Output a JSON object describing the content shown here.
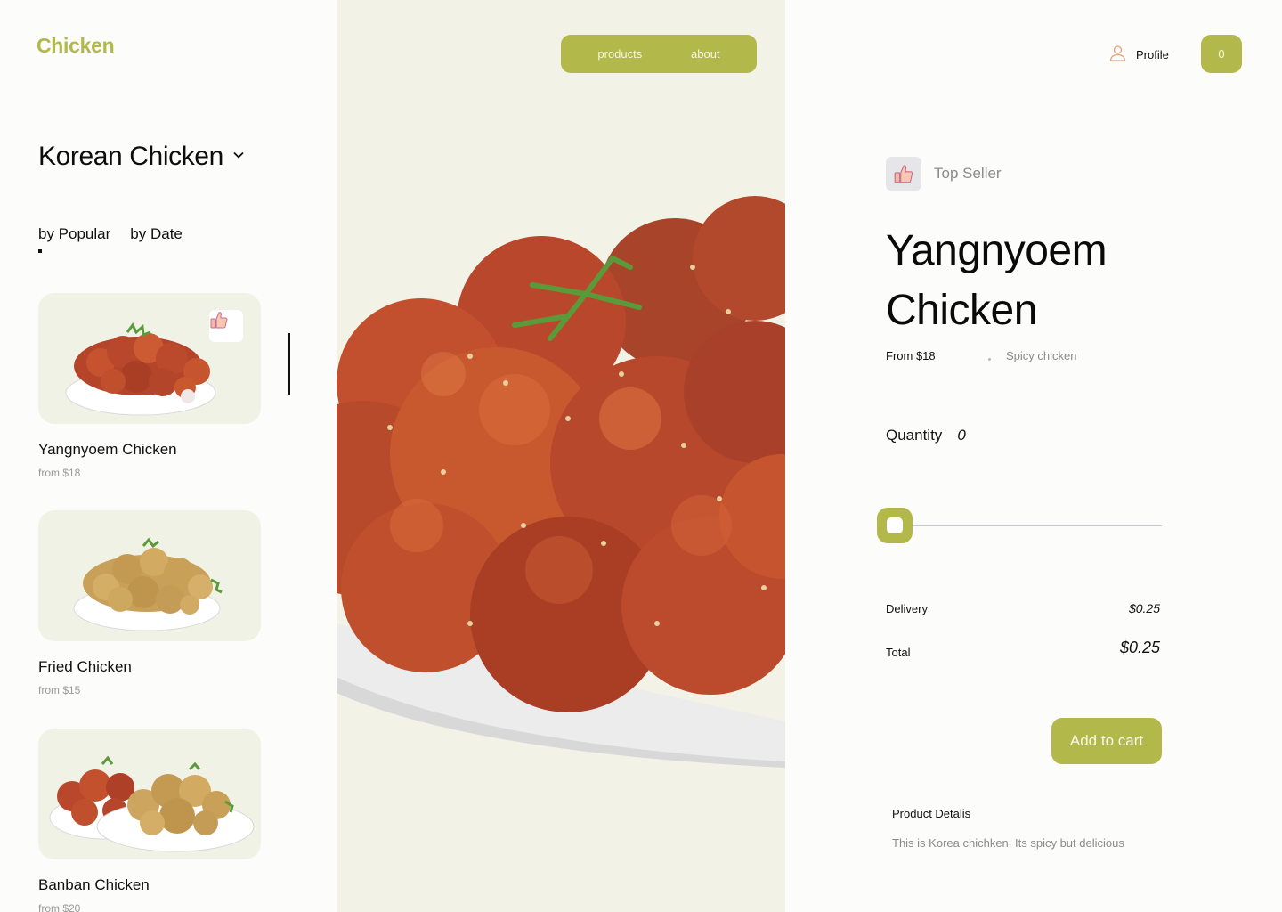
{
  "brand": {
    "logo": "Chicken",
    "accent": "#b3b84a"
  },
  "nav": {
    "items": [
      {
        "label": "products"
      },
      {
        "label": "about"
      }
    ]
  },
  "header": {
    "profile_label": "Profile",
    "cart_count": "0"
  },
  "category": {
    "title": "Korean Chicken",
    "icon": "chevron-down-icon"
  },
  "sort": {
    "tabs": [
      {
        "label": "by Popular"
      },
      {
        "label": "by Date"
      }
    ],
    "active": "by Popular"
  },
  "products": [
    {
      "name": "Yangnyoem Chicken",
      "price": "from $18",
      "liked": true,
      "icon": "thumbs-up-icon"
    },
    {
      "name": "Fried Chicken",
      "price": "from $15",
      "liked": false
    },
    {
      "name": "Banban Chicken",
      "price": "from $20",
      "liked": false
    }
  ],
  "detail": {
    "badge": "Top Seller",
    "badge_icon": "thumbs-up-icon",
    "name": "Yangnyoem Chicken",
    "price_from": "From $18",
    "tag": "Spicy chicken",
    "quantity_label": "Quantity",
    "quantity_value": "0",
    "quantity_slider_level": 0,
    "delivery_label": "Delivery",
    "delivery_value": "$0.25",
    "total_label": "Total",
    "total_value": "$0.25",
    "add_to_cart": "Add to cart",
    "details_title": "Product Detalis",
    "details_text": "This is Korea chichken. Its spicy but delicious"
  }
}
